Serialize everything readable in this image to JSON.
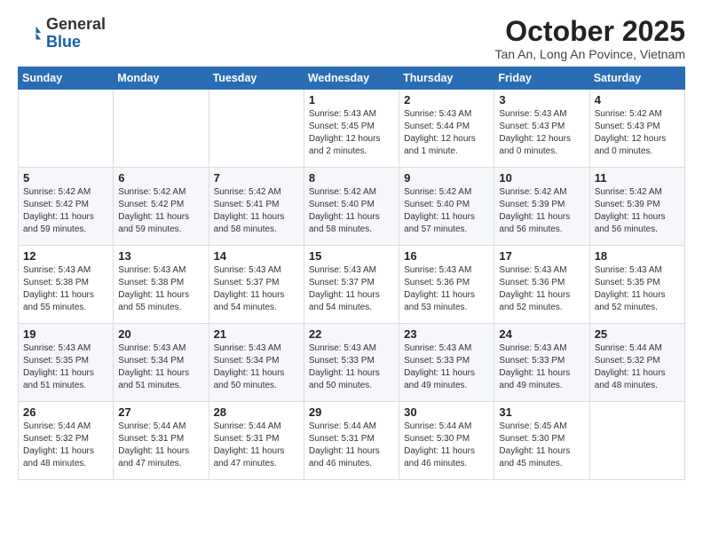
{
  "header": {
    "logo_general": "General",
    "logo_blue": "Blue",
    "month_title": "October 2025",
    "location": "Tan An, Long An Povince, Vietnam"
  },
  "days_of_week": [
    "Sunday",
    "Monday",
    "Tuesday",
    "Wednesday",
    "Thursday",
    "Friday",
    "Saturday"
  ],
  "weeks": [
    [
      {
        "day": "",
        "info": ""
      },
      {
        "day": "",
        "info": ""
      },
      {
        "day": "",
        "info": ""
      },
      {
        "day": "1",
        "info": "Sunrise: 5:43 AM\nSunset: 5:45 PM\nDaylight: 12 hours and 2 minutes."
      },
      {
        "day": "2",
        "info": "Sunrise: 5:43 AM\nSunset: 5:44 PM\nDaylight: 12 hours and 1 minute."
      },
      {
        "day": "3",
        "info": "Sunrise: 5:43 AM\nSunset: 5:43 PM\nDaylight: 12 hours and 0 minutes."
      },
      {
        "day": "4",
        "info": "Sunrise: 5:42 AM\nSunset: 5:43 PM\nDaylight: 12 hours and 0 minutes."
      }
    ],
    [
      {
        "day": "5",
        "info": "Sunrise: 5:42 AM\nSunset: 5:42 PM\nDaylight: 11 hours and 59 minutes."
      },
      {
        "day": "6",
        "info": "Sunrise: 5:42 AM\nSunset: 5:42 PM\nDaylight: 11 hours and 59 minutes."
      },
      {
        "day": "7",
        "info": "Sunrise: 5:42 AM\nSunset: 5:41 PM\nDaylight: 11 hours and 58 minutes."
      },
      {
        "day": "8",
        "info": "Sunrise: 5:42 AM\nSunset: 5:40 PM\nDaylight: 11 hours and 58 minutes."
      },
      {
        "day": "9",
        "info": "Sunrise: 5:42 AM\nSunset: 5:40 PM\nDaylight: 11 hours and 57 minutes."
      },
      {
        "day": "10",
        "info": "Sunrise: 5:42 AM\nSunset: 5:39 PM\nDaylight: 11 hours and 56 minutes."
      },
      {
        "day": "11",
        "info": "Sunrise: 5:42 AM\nSunset: 5:39 PM\nDaylight: 11 hours and 56 minutes."
      }
    ],
    [
      {
        "day": "12",
        "info": "Sunrise: 5:43 AM\nSunset: 5:38 PM\nDaylight: 11 hours and 55 minutes."
      },
      {
        "day": "13",
        "info": "Sunrise: 5:43 AM\nSunset: 5:38 PM\nDaylight: 11 hours and 55 minutes."
      },
      {
        "day": "14",
        "info": "Sunrise: 5:43 AM\nSunset: 5:37 PM\nDaylight: 11 hours and 54 minutes."
      },
      {
        "day": "15",
        "info": "Sunrise: 5:43 AM\nSunset: 5:37 PM\nDaylight: 11 hours and 54 minutes."
      },
      {
        "day": "16",
        "info": "Sunrise: 5:43 AM\nSunset: 5:36 PM\nDaylight: 11 hours and 53 minutes."
      },
      {
        "day": "17",
        "info": "Sunrise: 5:43 AM\nSunset: 5:36 PM\nDaylight: 11 hours and 52 minutes."
      },
      {
        "day": "18",
        "info": "Sunrise: 5:43 AM\nSunset: 5:35 PM\nDaylight: 11 hours and 52 minutes."
      }
    ],
    [
      {
        "day": "19",
        "info": "Sunrise: 5:43 AM\nSunset: 5:35 PM\nDaylight: 11 hours and 51 minutes."
      },
      {
        "day": "20",
        "info": "Sunrise: 5:43 AM\nSunset: 5:34 PM\nDaylight: 11 hours and 51 minutes."
      },
      {
        "day": "21",
        "info": "Sunrise: 5:43 AM\nSunset: 5:34 PM\nDaylight: 11 hours and 50 minutes."
      },
      {
        "day": "22",
        "info": "Sunrise: 5:43 AM\nSunset: 5:33 PM\nDaylight: 11 hours and 50 minutes."
      },
      {
        "day": "23",
        "info": "Sunrise: 5:43 AM\nSunset: 5:33 PM\nDaylight: 11 hours and 49 minutes."
      },
      {
        "day": "24",
        "info": "Sunrise: 5:43 AM\nSunset: 5:33 PM\nDaylight: 11 hours and 49 minutes."
      },
      {
        "day": "25",
        "info": "Sunrise: 5:44 AM\nSunset: 5:32 PM\nDaylight: 11 hours and 48 minutes."
      }
    ],
    [
      {
        "day": "26",
        "info": "Sunrise: 5:44 AM\nSunset: 5:32 PM\nDaylight: 11 hours and 48 minutes."
      },
      {
        "day": "27",
        "info": "Sunrise: 5:44 AM\nSunset: 5:31 PM\nDaylight: 11 hours and 47 minutes."
      },
      {
        "day": "28",
        "info": "Sunrise: 5:44 AM\nSunset: 5:31 PM\nDaylight: 11 hours and 47 minutes."
      },
      {
        "day": "29",
        "info": "Sunrise: 5:44 AM\nSunset: 5:31 PM\nDaylight: 11 hours and 46 minutes."
      },
      {
        "day": "30",
        "info": "Sunrise: 5:44 AM\nSunset: 5:30 PM\nDaylight: 11 hours and 46 minutes."
      },
      {
        "day": "31",
        "info": "Sunrise: 5:45 AM\nSunset: 5:30 PM\nDaylight: 11 hours and 45 minutes."
      },
      {
        "day": "",
        "info": ""
      }
    ]
  ]
}
